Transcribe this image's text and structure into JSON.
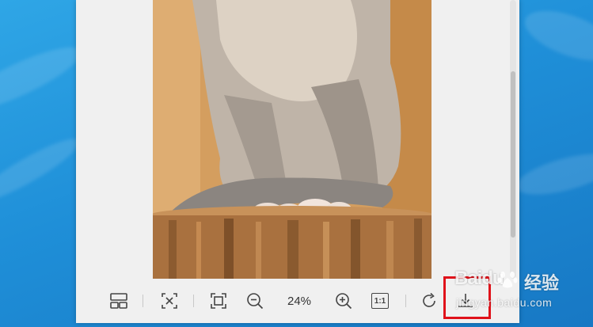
{
  "viewer": {
    "zoom_level": "24%",
    "toolbar": {
      "thumbnails_icon": "thumbnails-icon",
      "fit_window_icon": "fit-window-icon",
      "fullscreen_icon": "fullscreen-icon",
      "zoom_out_icon": "zoom-out-icon",
      "zoom_in_icon": "zoom-in-icon",
      "actual_size_label": "1:1",
      "rotate_icon": "rotate-icon",
      "download_icon": "download-icon"
    },
    "image_subject": "photo"
  },
  "watermark": {
    "brand": "Baidu",
    "product": "经验",
    "url": "jingyan.baidu.com"
  },
  "colors": {
    "highlight": "#e0121a",
    "desktop_blue": "#1f8fd8",
    "viewer_bg": "#f0f0f0"
  }
}
